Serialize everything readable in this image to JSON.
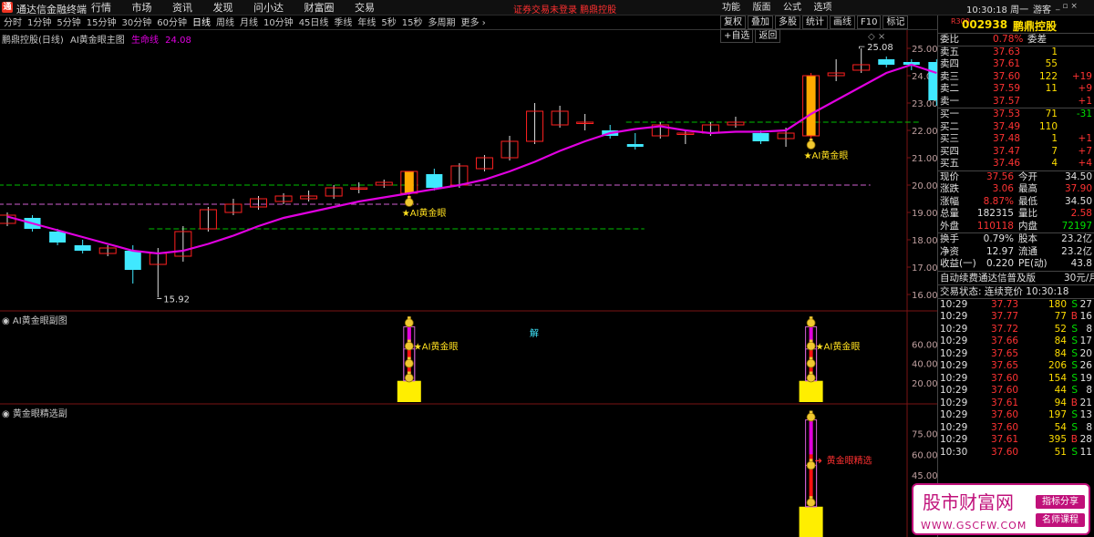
{
  "titlebar": {
    "logo": "通",
    "app_title": "通达信金融终端",
    "menu": [
      "行情",
      "市场",
      "资讯",
      "发现",
      "问小达",
      "财富圈",
      "交易"
    ],
    "notice": "证券交易未登录   鹏鼎控股",
    "right_menu": [
      "功能",
      "版面",
      "公式",
      "选项"
    ],
    "clock": "10:30:18 周一",
    "user": "游客",
    "window_buttons": "_ ▫ ×"
  },
  "periodbar": {
    "periods": [
      "分时",
      "1分钟",
      "5分钟",
      "15分钟",
      "30分钟",
      "60分钟",
      "日线",
      "周线",
      "月线",
      "10分钟",
      "45日线",
      "季线",
      "年线",
      "5秒",
      "15秒",
      "多周期",
      "更多 ›"
    ],
    "tools": [
      "复权",
      "叠加",
      "多股",
      "统计",
      "画线",
      "F10",
      "标记",
      "+自选",
      "返回"
    ]
  },
  "main_panel": {
    "stock_label": "鹏鼎控股(日线)",
    "indicator_name": "AI黄金眼主图",
    "line_name": "生命线",
    "line_value": "24.08",
    "high_label": "25.08",
    "low_label": "15.92",
    "signal_label": "★AI黄金眼",
    "center_glyph": "解",
    "top_icons": "◇ ×"
  },
  "sub_panel1": {
    "title": "AI黄金眼副图",
    "signal_label": "★AI黄金眼"
  },
  "sub_panel2": {
    "title": "黄金眼精选副",
    "signal_label": "黄金眼精选"
  },
  "chart_data": [
    {
      "type": "candlestick",
      "title": "AI黄金眼主图",
      "y_ticks": [
        25.0,
        24.0,
        23.0,
        22.0,
        21.0,
        20.0,
        19.0,
        18.0,
        17.0,
        16.0
      ],
      "ylim": [
        15.5,
        25.4
      ],
      "candles": [
        {
          "o": 18.9,
          "h": 19.0,
          "l": 18.5,
          "c": 18.6,
          "s": "flat"
        },
        {
          "o": 18.8,
          "h": 18.9,
          "l": 18.3,
          "c": 18.4,
          "s": "down"
        },
        {
          "o": 18.3,
          "h": 18.4,
          "l": 17.8,
          "c": 17.9,
          "s": "down"
        },
        {
          "o": 17.8,
          "h": 18.0,
          "l": 17.5,
          "c": 17.6,
          "s": "down"
        },
        {
          "o": 17.7,
          "h": 17.8,
          "l": 17.4,
          "c": 17.5,
          "s": "flat"
        },
        {
          "o": 17.6,
          "h": 17.8,
          "l": 16.4,
          "c": 16.9,
          "s": "down"
        },
        {
          "o": 17.1,
          "h": 17.7,
          "l": 15.9,
          "c": 17.5,
          "s": "flat"
        },
        {
          "o": 17.4,
          "h": 18.5,
          "l": 17.2,
          "c": 18.3,
          "s": "flat"
        },
        {
          "o": 18.4,
          "h": 19.2,
          "l": 18.3,
          "c": 19.1,
          "s": "flat"
        },
        {
          "o": 19.0,
          "h": 19.5,
          "l": 18.9,
          "c": 19.3,
          "s": "flat"
        },
        {
          "o": 19.2,
          "h": 19.6,
          "l": 19.1,
          "c": 19.5,
          "s": "flat"
        },
        {
          "o": 19.4,
          "h": 19.7,
          "l": 19.3,
          "c": 19.6,
          "s": "flat"
        },
        {
          "o": 19.5,
          "h": 19.8,
          "l": 19.4,
          "c": 19.6,
          "s": "flat"
        },
        {
          "o": 19.6,
          "h": 20.0,
          "l": 19.5,
          "c": 19.9,
          "s": "flat"
        },
        {
          "o": 19.9,
          "h": 20.1,
          "l": 19.7,
          "c": 19.9,
          "s": "flat"
        },
        {
          "o": 20.0,
          "h": 20.2,
          "l": 19.9,
          "c": 20.1,
          "s": "flat"
        },
        {
          "o": 19.7,
          "h": 20.5,
          "l": 19.6,
          "c": 20.5,
          "s": "up"
        },
        {
          "o": 19.9,
          "h": 20.6,
          "l": 19.8,
          "c": 20.4,
          "s": "down"
        },
        {
          "o": 20.0,
          "h": 20.8,
          "l": 19.9,
          "c": 20.7,
          "s": "flat"
        },
        {
          "o": 20.6,
          "h": 21.1,
          "l": 20.5,
          "c": 21.0,
          "s": "flat"
        },
        {
          "o": 21.0,
          "h": 21.8,
          "l": 20.9,
          "c": 21.6,
          "s": "flat"
        },
        {
          "o": 21.6,
          "h": 23.0,
          "l": 21.5,
          "c": 22.7,
          "s": "flat"
        },
        {
          "o": 22.7,
          "h": 22.9,
          "l": 22.1,
          "c": 22.2,
          "s": "flat"
        },
        {
          "o": 22.3,
          "h": 22.6,
          "l": 22.0,
          "c": 22.3,
          "s": "flat"
        },
        {
          "o": 22.0,
          "h": 22.2,
          "l": 21.7,
          "c": 21.8,
          "s": "down"
        },
        {
          "o": 21.4,
          "h": 21.9,
          "l": 21.3,
          "c": 21.5,
          "s": "down"
        },
        {
          "o": 21.8,
          "h": 22.3,
          "l": 21.7,
          "c": 22.2,
          "s": "flat"
        },
        {
          "o": 21.9,
          "h": 22.0,
          "l": 21.5,
          "c": 21.9,
          "s": "flat"
        },
        {
          "o": 21.9,
          "h": 22.3,
          "l": 21.8,
          "c": 22.2,
          "s": "flat"
        },
        {
          "o": 22.2,
          "h": 22.5,
          "l": 22.1,
          "c": 22.3,
          "s": "flat"
        },
        {
          "o": 21.9,
          "h": 22.0,
          "l": 21.5,
          "c": 21.6,
          "s": "down"
        },
        {
          "o": 21.9,
          "h": 22.1,
          "l": 21.4,
          "c": 21.7,
          "s": "flat"
        },
        {
          "o": 21.8,
          "h": 24.1,
          "l": 21.7,
          "c": 24.0,
          "s": "up"
        },
        {
          "o": 24.0,
          "h": 24.6,
          "l": 23.8,
          "c": 24.1,
          "s": "flat"
        },
        {
          "o": 24.2,
          "h": 25.0,
          "l": 24.1,
          "c": 24.4,
          "s": "flat"
        },
        {
          "o": 24.6,
          "h": 24.7,
          "l": 24.3,
          "c": 24.4,
          "s": "down"
        },
        {
          "o": 24.5,
          "h": 24.6,
          "l": 24.2,
          "c": 24.4,
          "s": "down"
        },
        {
          "o": 24.5,
          "h": 24.6,
          "l": 22.9,
          "c": 23.1,
          "s": "down"
        }
      ],
      "life_line": [
        18.85,
        18.6,
        18.35,
        18.1,
        17.85,
        17.6,
        17.5,
        17.6,
        17.85,
        18.15,
        18.5,
        18.8,
        19.0,
        19.2,
        19.4,
        19.55,
        19.7,
        19.85,
        20.0,
        20.2,
        20.5,
        20.85,
        21.25,
        21.6,
        21.9,
        22.05,
        22.15,
        22.0,
        21.9,
        21.95,
        21.95,
        22.0,
        22.6,
        23.1,
        23.6,
        24.1,
        24.4,
        24.1
      ],
      "dashed_levels": [
        {
          "value": 20.0,
          "from": 0,
          "to": 16,
          "color": "#00c000"
        },
        {
          "value": 19.3,
          "from": 0,
          "to": 16,
          "color": "#d060d0"
        },
        {
          "value": 18.4,
          "from": 6,
          "to": 25,
          "color": "#00c000"
        },
        {
          "value": 20.0,
          "from": 18,
          "to": 34,
          "color": "#d060d0"
        },
        {
          "value": 22.3,
          "from": 25,
          "to": 36,
          "color": "#00c000"
        }
      ],
      "signals": [
        16,
        32
      ]
    },
    {
      "type": "bar",
      "title": "AI黄金眼副图",
      "y_ticks": [
        60.0,
        40.0,
        20.0
      ],
      "ylim": [
        0,
        85
      ],
      "signals": [
        16,
        32
      ]
    },
    {
      "type": "bar",
      "title": "黄金眼精选副",
      "y_ticks": [
        75.0,
        60.0,
        45.0,
        30.0,
        15.0
      ],
      "ylim": [
        0,
        90
      ],
      "signals": [
        32
      ]
    }
  ],
  "quote": {
    "mk": "R300",
    "code": "002938",
    "name": "鹏鼎控股",
    "ratio_label": "委比",
    "ratio_value": "0.78%",
    "diff_label": "委差",
    "asks": [
      {
        "label": "卖五",
        "price": "37.63",
        "vol": "1",
        "chg": ""
      },
      {
        "label": "卖四",
        "price": "37.61",
        "vol": "55",
        "chg": ""
      },
      {
        "label": "卖三",
        "price": "37.60",
        "vol": "122",
        "chg": "+19"
      },
      {
        "label": "卖二",
        "price": "37.59",
        "vol": "11",
        "chg": "+9"
      },
      {
        "label": "卖一",
        "price": "37.57",
        "vol": "",
        "chg": "+1"
      }
    ],
    "bids": [
      {
        "label": "买一",
        "price": "37.53",
        "vol": "71",
        "chg": "-31"
      },
      {
        "label": "买二",
        "price": "37.49",
        "vol": "110",
        "chg": ""
      },
      {
        "label": "买三",
        "price": "37.48",
        "vol": "1",
        "chg": "+1"
      },
      {
        "label": "买四",
        "price": "37.47",
        "vol": "7",
        "chg": "+7"
      },
      {
        "label": "买五",
        "price": "37.46",
        "vol": "4",
        "chg": "+4"
      }
    ],
    "stats": [
      {
        "l1": "现价",
        "v1": "37.56",
        "c1": "red",
        "l2": "今开",
        "v2": "34.50",
        "c2": "white"
      },
      {
        "l1": "涨跌",
        "v1": "3.06",
        "c1": "red",
        "l2": "最高",
        "v2": "37.90",
        "c2": "red"
      },
      {
        "l1": "涨幅",
        "v1": "8.87%",
        "c1": "red",
        "l2": "最低",
        "v2": "34.50",
        "c2": "white"
      },
      {
        "l1": "总量",
        "v1": "182315",
        "c1": "white",
        "l2": "量比",
        "v2": "2.58",
        "c2": "red"
      },
      {
        "l1": "外盘",
        "v1": "110118",
        "c1": "red",
        "l2": "内盘",
        "v2": "72197",
        "c2": "green"
      }
    ],
    "stats2": [
      {
        "l1": "换手",
        "v1": "0.79%",
        "l2": "股本",
        "v2": "23.2亿"
      },
      {
        "l1": "净资",
        "v1": "12.97",
        "l2": "流通",
        "v2": "23.2亿"
      },
      {
        "l1": "收益(一)",
        "v1": "0.220",
        "l2": "PE(动)",
        "v2": "43.8"
      }
    ],
    "promo": "自动续费通达信普及版",
    "promo_price": "30元/月",
    "trade_status": "交易状态: 连续竞价 10:30:18",
    "ticks": [
      {
        "t": "10:29",
        "p": "37.73",
        "v": "180",
        "s": "S",
        "n": "27"
      },
      {
        "t": "10:29",
        "p": "37.77",
        "v": "77",
        "s": "B",
        "n": "16"
      },
      {
        "t": "10:29",
        "p": "37.72",
        "v": "52",
        "s": "S",
        "n": "8"
      },
      {
        "t": "10:29",
        "p": "37.66",
        "v": "84",
        "s": "S",
        "n": "17"
      },
      {
        "t": "10:29",
        "p": "37.65",
        "v": "84",
        "s": "S",
        "n": "20"
      },
      {
        "t": "10:29",
        "p": "37.65",
        "v": "206",
        "s": "S",
        "n": "26"
      },
      {
        "t": "10:29",
        "p": "37.60",
        "v": "154",
        "s": "S",
        "n": "19"
      },
      {
        "t": "10:29",
        "p": "37.60",
        "v": "44",
        "s": "S",
        "n": "8"
      },
      {
        "t": "10:29",
        "p": "37.61",
        "v": "94",
        "s": "B",
        "n": "21"
      },
      {
        "t": "10:29",
        "p": "37.60",
        "v": "197",
        "s": "S",
        "n": "13"
      },
      {
        "t": "10:29",
        "p": "37.60",
        "v": "54",
        "s": "S",
        "n": "8"
      },
      {
        "t": "10:29",
        "p": "37.61",
        "v": "395",
        "s": "B",
        "n": "28"
      },
      {
        "t": "10:30",
        "p": "37.60",
        "v": "51",
        "s": "S",
        "n": "11"
      }
    ]
  },
  "watermark": {
    "title": "股市财富网",
    "url": "WWW.GSCFW.COM",
    "tag1": "指标分享",
    "tag2": "名师课程"
  },
  "colors": {
    "up": "#ff2020",
    "down": "#40e8ff",
    "flat": "#e0e0e0",
    "life_line": "#e000e0",
    "signal": "#ffe020",
    "axis": "#c0a0a0"
  }
}
